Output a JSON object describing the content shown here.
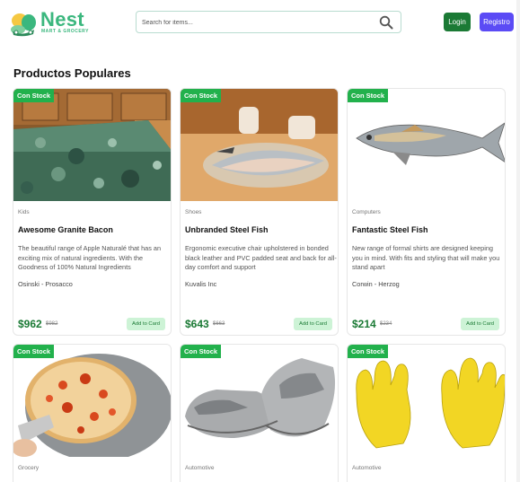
{
  "header": {
    "logo_name": "Nest",
    "logo_tagline": "MART & GROCERY",
    "search_placeholder": "Search for items...",
    "login_label": "Login",
    "register_label": "Registro"
  },
  "section_title": "Productos Populares",
  "products": [
    {
      "badge": "Con Stock",
      "category": "Kids",
      "title": "Awesome Granite Bacon",
      "description": "The beautiful range of Apple Naturalé that has an exciting mix of natural ingredients. With the Goodness of 100% Natural Ingredients",
      "vendor": "Osinski - Prosacco",
      "price": "$962",
      "old_price": "$982",
      "button": "Add to Card",
      "image": "granite-countertop"
    },
    {
      "badge": "Con Stock",
      "category": "Shoes",
      "title": "Unbranded Steel Fish",
      "description": "Ergonomic executive chair upholstered in bonded black leather and PVC padded seat and back for all-day comfort and support",
      "vendor": "Kuvalis Inc",
      "price": "$643",
      "old_price": "$663",
      "button": "Add to Card",
      "image": "fish-filleting"
    },
    {
      "badge": "Con Stock",
      "category": "Computers",
      "title": "Fantastic Steel Fish",
      "description": "New range of formal shirts are designed keeping you in mind. With fits and styling that will make you stand apart",
      "vendor": "Corwin - Herzog",
      "price": "$214",
      "old_price": "$234",
      "button": "Add to Card",
      "image": "steel-fish-sculpture"
    },
    {
      "badge": "Con Stock",
      "category": "Grocery",
      "image": "pizza-on-stone"
    },
    {
      "badge": "Con Stock",
      "category": "Automotive",
      "image": "grey-slippers"
    },
    {
      "badge": "Con Stock",
      "category": "Automotive",
      "image": "yellow-rubber-gloves"
    }
  ],
  "colors": {
    "brand_green": "#3bb77e",
    "price_green": "#1b7a35",
    "badge_green": "#22b14c",
    "login_bg": "#1b7a35",
    "register_bg": "#5b4bf5",
    "add_btn_bg": "#cdf3d6"
  }
}
